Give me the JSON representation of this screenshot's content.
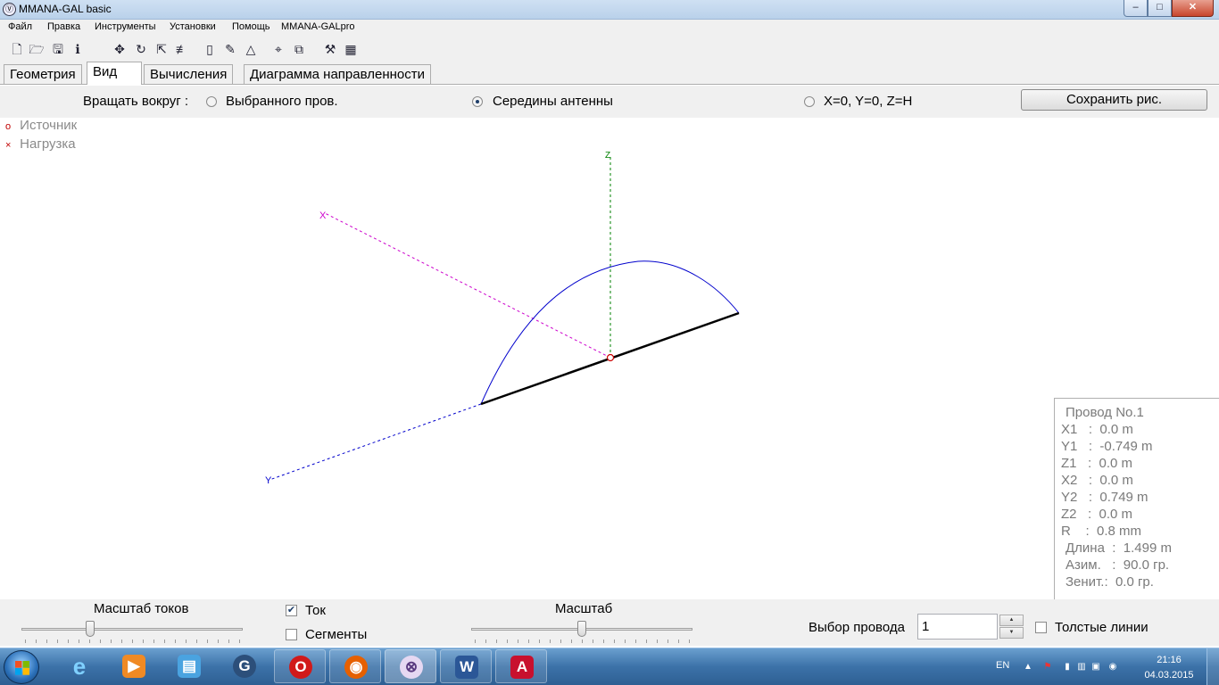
{
  "window": {
    "title": "MMANA-GAL basic",
    "min_glyph": "–",
    "max_glyph": "□",
    "close_glyph": "✕"
  },
  "menu": [
    "Файл",
    "Правка",
    "Инструменты",
    "Установки",
    "Помощь",
    "MMANA-GALpro"
  ],
  "toolbar_icons": [
    "new-file-icon",
    "open-folder-icon",
    "save-icon",
    "info-icon",
    "move-icon",
    "rotate-icon",
    "stretch-icon",
    "wires-icon",
    "page-icon",
    "pencil-icon",
    "triangle-icon",
    "target-icon",
    "copy-icon",
    "tools-icon",
    "calculator-icon"
  ],
  "tabs": [
    {
      "label": "Геометрия",
      "active": false
    },
    {
      "label": "Вид",
      "active": true
    },
    {
      "label": "Вычисления",
      "active": false
    },
    {
      "label": "Диаграмма направленности",
      "active": false
    }
  ],
  "rotate": {
    "label": "Вращать вокруг :",
    "options": [
      {
        "label": "Выбранного пров.",
        "selected": false
      },
      {
        "label": "Середины антенны",
        "selected": true
      },
      {
        "label": "X=0, Y=0, Z=H",
        "selected": false
      }
    ],
    "save_button": "Сохранить рис."
  },
  "legend": [
    {
      "symbol": "o",
      "label": "Источник"
    },
    {
      "symbol": "×",
      "label": "Нагрузка"
    }
  ],
  "axes": {
    "x_label": "X",
    "y_label": "Y",
    "z_label": "Z"
  },
  "wire_info": {
    "title": "Провод No.1",
    "x1": "X1   :  0.0 m",
    "y1": "Y1   :  -0.749 m",
    "z1": "Z1   :  0.0 m",
    "x2": "X2   :  0.0 m",
    "y2": "Y2   :  0.749 m",
    "z2": "Z2   :  0.0 m",
    "r": "R    :  0.8 mm",
    "length": "Длина  :  1.499 m",
    "azimuth": "Азим.   :  90.0 гр.",
    "zenith": "Зенит.:  0.0 гр."
  },
  "bottom": {
    "current_scale_label": "Масштаб токов",
    "current_checkbox": {
      "label": "Ток",
      "checked": true
    },
    "segments_checkbox": {
      "label": "Сегменты",
      "checked": false
    },
    "scale_label": "Масштаб",
    "wire_select_label": "Выбор провода",
    "wire_select_value": "1",
    "thick_lines": {
      "label": "Толстые линии",
      "checked": false
    }
  },
  "colors": {
    "x_axis": "#cc00cc",
    "y_axis": "#0000cc",
    "z_axis": "#008000",
    "wire": "#000000",
    "current": "#0000cc",
    "source": "#cc0000"
  },
  "taskbar": {
    "apps": [
      "internet-explorer",
      "media-player",
      "files",
      "graph-app",
      "opera",
      "firefox",
      "mmana-gal",
      "word",
      "acrobat"
    ],
    "language": "EN",
    "time": "21:16",
    "date": "04.03.2015"
  }
}
